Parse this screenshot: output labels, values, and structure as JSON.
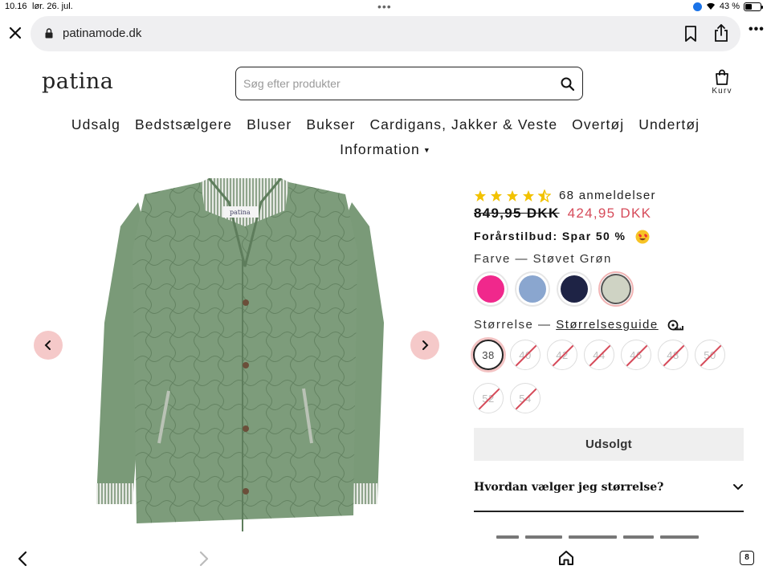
{
  "status_bar": {
    "time": "10.16",
    "date": "lør. 26. jul.",
    "battery": "43 %",
    "battery_level": 0.43
  },
  "browser": {
    "url": "patinamode.dk",
    "tab_count": "8"
  },
  "header": {
    "logo": "patina",
    "search_placeholder": "Søg efter produkter",
    "cart_label": "Kurv"
  },
  "nav": {
    "items": [
      "Udsalg",
      "Bedstsælgere",
      "Bluser",
      "Bukser",
      "Cardigans, Jakker & Veste",
      "Overtøj",
      "Undertøj"
    ],
    "info": "Information"
  },
  "product": {
    "rating": 4.5,
    "reviews": "68 anmeldelser",
    "old_price": "849,95 DKK",
    "new_price": "424,95 DKK",
    "promo": "Forårstilbud: Spar 50 %",
    "color_label": "Farve — Støvet Grøn",
    "colors": [
      {
        "name": "pink",
        "hex": "#f0288c"
      },
      {
        "name": "light-blue",
        "hex": "#8aa6cf"
      },
      {
        "name": "navy",
        "hex": "#1e2345"
      },
      {
        "name": "sage",
        "hex": "#cfd3c4"
      }
    ],
    "selected_color_index": 3,
    "size_label_prefix": "Størrelse —",
    "size_guide": "Størrelsesguide",
    "sizes": [
      {
        "label": "38",
        "available": true
      },
      {
        "label": "40",
        "available": false
      },
      {
        "label": "42",
        "available": false
      },
      {
        "label": "44",
        "available": false
      },
      {
        "label": "46",
        "available": false
      },
      {
        "label": "48",
        "available": false
      },
      {
        "label": "50",
        "available": false
      },
      {
        "label": "52",
        "available": false
      },
      {
        "label": "54",
        "available": false
      }
    ],
    "button": "Udsolgt",
    "accordion": "Hvordan vælger jeg størrelse?"
  },
  "colors": {
    "accent": "#d64b5a",
    "arrow_bg": "#f5c9c9",
    "jacket": "#7a9a78"
  }
}
